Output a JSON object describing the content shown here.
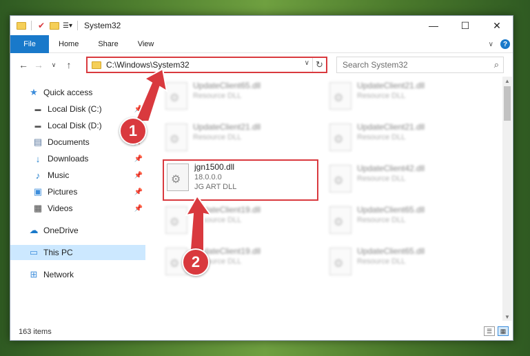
{
  "window": {
    "title": "System32",
    "controls": {
      "minimize": "—",
      "maximize": "☐",
      "close": "✕"
    }
  },
  "ribbon": {
    "tabs": [
      "File",
      "Home",
      "Share",
      "View"
    ],
    "help": "?"
  },
  "nav": {
    "back": "←",
    "forward": "→",
    "recent": "∨",
    "up": "↑"
  },
  "address": {
    "path": "C:\\Windows\\System32",
    "dropdown": "∨",
    "refresh": "↻"
  },
  "search": {
    "placeholder": "Search System32",
    "icon": "⌕"
  },
  "navpane": {
    "quick_access": "Quick access",
    "items": [
      {
        "label": "Local Disk (C:)",
        "icon": "drive-icon",
        "pinned": true
      },
      {
        "label": "Local Disk (D:)",
        "icon": "drive-icon",
        "pinned": false
      },
      {
        "label": "Documents",
        "icon": "documents-icon",
        "pinned": true
      },
      {
        "label": "Downloads",
        "icon": "downloads-icon",
        "pinned": true
      },
      {
        "label": "Music",
        "icon": "music-icon",
        "pinned": true
      },
      {
        "label": "Pictures",
        "icon": "pictures-icon",
        "pinned": true
      },
      {
        "label": "Videos",
        "icon": "videos-icon",
        "pinned": true
      }
    ],
    "onedrive": "OneDrive",
    "this_pc": "This PC",
    "network": "Network"
  },
  "files": {
    "left": [
      {
        "name": "UpdateClient65.dll",
        "type": "Resource DLL"
      },
      {
        "name": "UpdateClient21.dll",
        "type": "Resource DLL"
      },
      {
        "name": "jgn1500.dll",
        "version": "18.0.0.0",
        "type": "JG ART DLL"
      },
      {
        "name": "UpdateClient19.dll",
        "type": "Resource DLL"
      },
      {
        "name": "UpdateClient19.dll",
        "type": "Resource DLL"
      }
    ],
    "right": [
      {
        "name": "UpdateClient21.dll",
        "type": "Resource DLL"
      },
      {
        "name": "UpdateClient21.dll",
        "type": "Resource DLL"
      },
      {
        "name": "UpdateClient42.dll",
        "type": "Resource DLL"
      },
      {
        "name": "UpdateClient65.dll",
        "type": "Resource DLL"
      },
      {
        "name": "UpdateClient65.dll",
        "type": "Resource DLL"
      }
    ]
  },
  "status": {
    "count": "163 items"
  },
  "annotations": {
    "step1": "1",
    "step2": "2",
    "color": "#d9393e"
  }
}
